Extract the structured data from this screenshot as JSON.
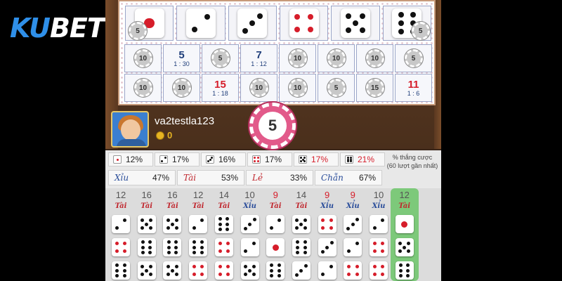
{
  "logo": {
    "ku": "KU",
    "bet": "BET"
  },
  "board": {
    "dice": [
      1,
      2,
      3,
      4,
      5,
      6
    ],
    "dice_chip": "5",
    "cells": [
      {
        "num": "",
        "ratio": "",
        "chip": "10",
        "red": false
      },
      {
        "num": "5",
        "ratio": "1 : 30",
        "chip": "",
        "red": false
      },
      {
        "num": "",
        "ratio": "",
        "chip": "5",
        "red": false
      },
      {
        "num": "7",
        "ratio": "1 : 12",
        "chip": "",
        "red": false
      },
      {
        "num": "",
        "ratio": "",
        "chip": "10",
        "red": false
      },
      {
        "num": "",
        "ratio": "",
        "chip": "10",
        "red": false
      },
      {
        "num": "",
        "ratio": "",
        "chip": "10",
        "red": false
      },
      {
        "num": "",
        "ratio": "",
        "chip": "5",
        "red": false
      },
      {
        "num": "",
        "ratio": "",
        "chip": "10",
        "red": false
      },
      {
        "num": "",
        "ratio": "",
        "chip": "10",
        "red": false
      },
      {
        "num": "15",
        "ratio": "1 : 18",
        "chip": "",
        "red": true
      },
      {
        "num": "",
        "ratio": "",
        "chip": "10",
        "red": false
      },
      {
        "num": "",
        "ratio": "",
        "chip": "10",
        "red": false
      },
      {
        "num": "",
        "ratio": "",
        "chip": "5",
        "red": false
      },
      {
        "num": "",
        "ratio": "",
        "chip": "15",
        "red": false
      },
      {
        "num": "11",
        "ratio": "1 : 6",
        "chip": "",
        "red": true
      }
    ]
  },
  "player": {
    "username": "va2testla123",
    "coins": "0"
  },
  "big_chip": "5",
  "stats": {
    "faces": [
      {
        "face": 1,
        "pct": "12%",
        "hl": false
      },
      {
        "face": 2,
        "pct": "17%",
        "hl": false
      },
      {
        "face": 3,
        "pct": "16%",
        "hl": false
      },
      {
        "face": 4,
        "pct": "17%",
        "hl": false
      },
      {
        "face": 5,
        "pct": "17%",
        "hl": true
      },
      {
        "face": 6,
        "pct": "21%",
        "hl": true
      }
    ],
    "bets": [
      {
        "label": "Xỉu",
        "pct": "47%",
        "color": "blue"
      },
      {
        "label": "Tài",
        "pct": "53%",
        "color": "red"
      },
      {
        "label": "Lẻ",
        "pct": "33%",
        "color": "red"
      },
      {
        "label": "Chẵn",
        "pct": "67%",
        "color": "blue"
      }
    ],
    "note_line1": "% thắng cược",
    "note_line2": "(60 lượt gần nhất)"
  },
  "history": [
    {
      "sum": "12",
      "res": "Tài",
      "dice": [
        2,
        4,
        6
      ],
      "sumred": false,
      "hl": false
    },
    {
      "sum": "16",
      "res": "Tài",
      "dice": [
        5,
        6,
        5
      ],
      "sumred": false,
      "hl": false
    },
    {
      "sum": "16",
      "res": "Tài",
      "dice": [
        5,
        6,
        5
      ],
      "sumred": false,
      "hl": false
    },
    {
      "sum": "12",
      "res": "Tài",
      "dice": [
        2,
        6,
        4
      ],
      "sumred": false,
      "hl": false
    },
    {
      "sum": "14",
      "res": "Tài",
      "dice": [
        6,
        4,
        4
      ],
      "sumred": false,
      "hl": false
    },
    {
      "sum": "10",
      "res": "Xỉu",
      "dice": [
        3,
        2,
        5
      ],
      "sumred": false,
      "hl": false
    },
    {
      "sum": "9",
      "res": "Tài",
      "dice": [
        2,
        1,
        6
      ],
      "sumred": true,
      "hl": false
    },
    {
      "sum": "14",
      "res": "Tài",
      "dice": [
        5,
        6,
        3
      ],
      "sumred": false,
      "hl": false
    },
    {
      "sum": "9",
      "res": "Xỉu",
      "dice": [
        4,
        3,
        2
      ],
      "sumred": true,
      "hl": false
    },
    {
      "sum": "9",
      "res": "Xỉu",
      "dice": [
        3,
        2,
        4
      ],
      "sumred": true,
      "hl": false
    },
    {
      "sum": "10",
      "res": "Xỉu",
      "dice": [
        2,
        4,
        4
      ],
      "sumred": false,
      "hl": false
    },
    {
      "sum": "12",
      "res": "Tài",
      "dice": [
        1,
        5,
        6
      ],
      "sumred": false,
      "hl": true
    }
  ]
}
